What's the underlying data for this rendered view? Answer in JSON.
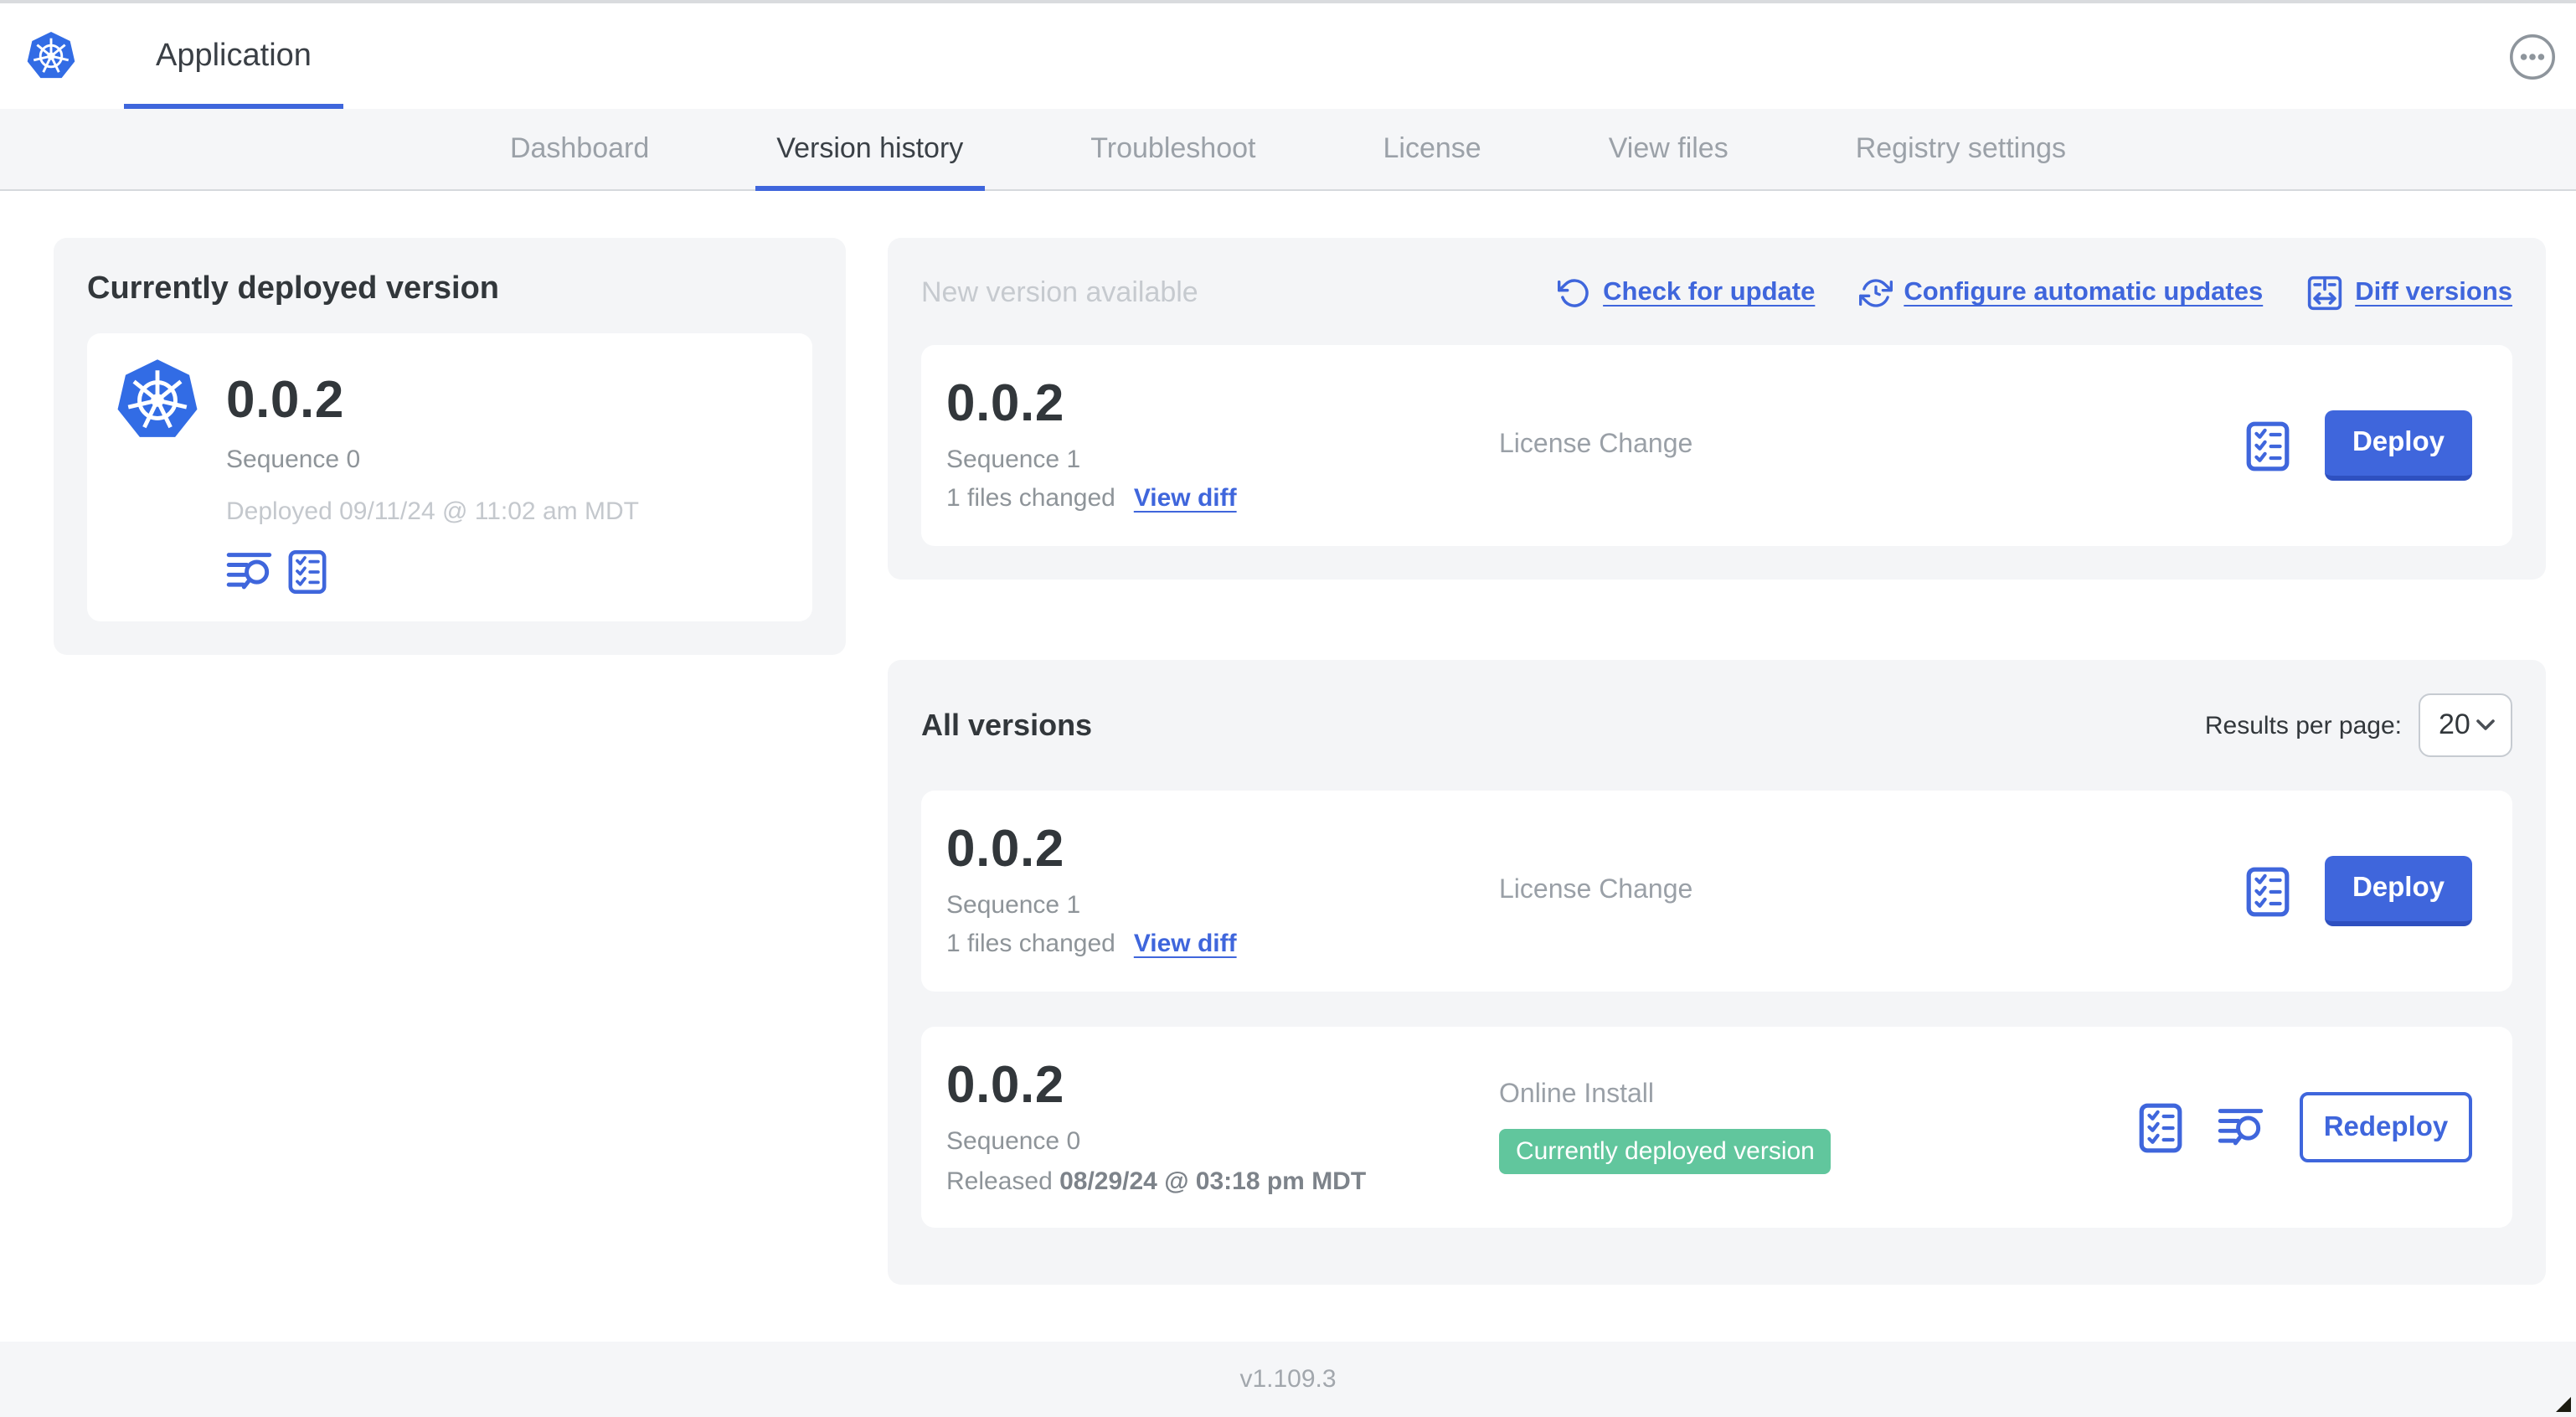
{
  "colors": {
    "accent": "#3f66dc",
    "button_blue": "#3f6ae3",
    "badge_green": "#61c69d",
    "panel_gray": "#f4f5f7",
    "k8s_blue": "#326ce5"
  },
  "appbar": {
    "app_name": "Application",
    "logo_icon": "kubernetes-logo",
    "menu_icon": "ellipsis-circle"
  },
  "nav": {
    "tabs": [
      {
        "label": "Dashboard",
        "active": false
      },
      {
        "label": "Version history",
        "active": true
      },
      {
        "label": "Troubleshoot",
        "active": false
      },
      {
        "label": "License",
        "active": false
      },
      {
        "label": "View files",
        "active": false
      },
      {
        "label": "Registry settings",
        "active": false
      }
    ]
  },
  "current_version": {
    "title": "Currently deployed version",
    "version": "0.0.2",
    "sequence": "Sequence 0",
    "deployed": "Deployed 09/11/24 @ 11:02 am MDT",
    "icons": [
      "view-logs",
      "preflight-checklist"
    ]
  },
  "new_version": {
    "title": "New version available",
    "actions": {
      "check_for_update": "Check for update",
      "configure_automatic_updates": "Configure automatic updates",
      "diff_versions": "Diff versions"
    },
    "card": {
      "version": "0.0.2",
      "sequence": "Sequence 1",
      "files_changed": "1 files changed",
      "view_diff": "View diff",
      "source": "License Change",
      "deploy": "Deploy"
    }
  },
  "all_versions": {
    "title": "All versions",
    "results_per_page_label": "Results per page:",
    "results_per_page_value": "20",
    "rows": [
      {
        "version": "0.0.2",
        "sequence": "Sequence 1",
        "files_changed": "1 files changed",
        "view_diff": "View diff",
        "source": "License Change",
        "action": "Deploy"
      },
      {
        "version": "0.0.2",
        "sequence": "Sequence 0",
        "released_label": "Released ",
        "released_date": "08/29/24 @ 03:18 pm MDT",
        "source": "Online Install",
        "badge": "Currently deployed version",
        "action": "Redeploy"
      }
    ]
  },
  "footer": {
    "app_version": "v1.109.3"
  }
}
